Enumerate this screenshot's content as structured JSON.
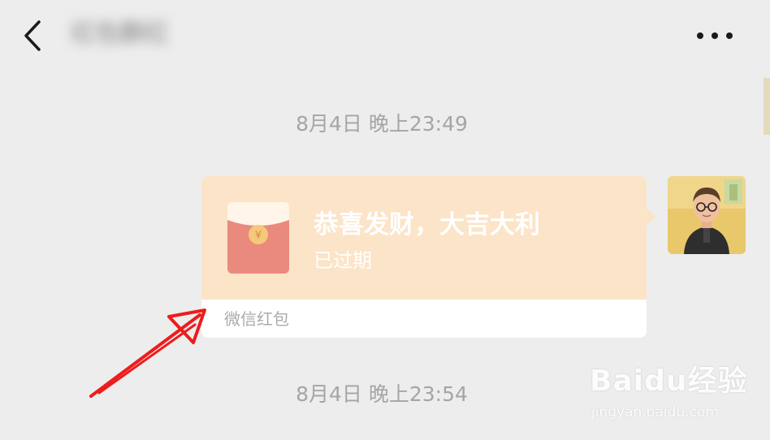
{
  "header": {
    "back_icon": "chevron-left-icon",
    "chat_title": "红包群红",
    "more_icon": "more-horizontal-icon"
  },
  "messages": [
    {
      "timestamp": "8月4日 晚上23:49"
    },
    {
      "timestamp": "8月4日 晚上23:54"
    }
  ],
  "red_packet": {
    "title": "恭喜发财，大吉大利",
    "status": "已过期",
    "source": "微信红包",
    "currency_symbol": "¥",
    "colors": {
      "background": "#fbe4c8",
      "envelope": "#ea8a7e",
      "coin": "#f5c97a"
    }
  },
  "annotation": {
    "color": "#ee1c1c"
  },
  "watermark": {
    "brand": "Baidu经验",
    "url": "jingyan.baidu.com"
  }
}
